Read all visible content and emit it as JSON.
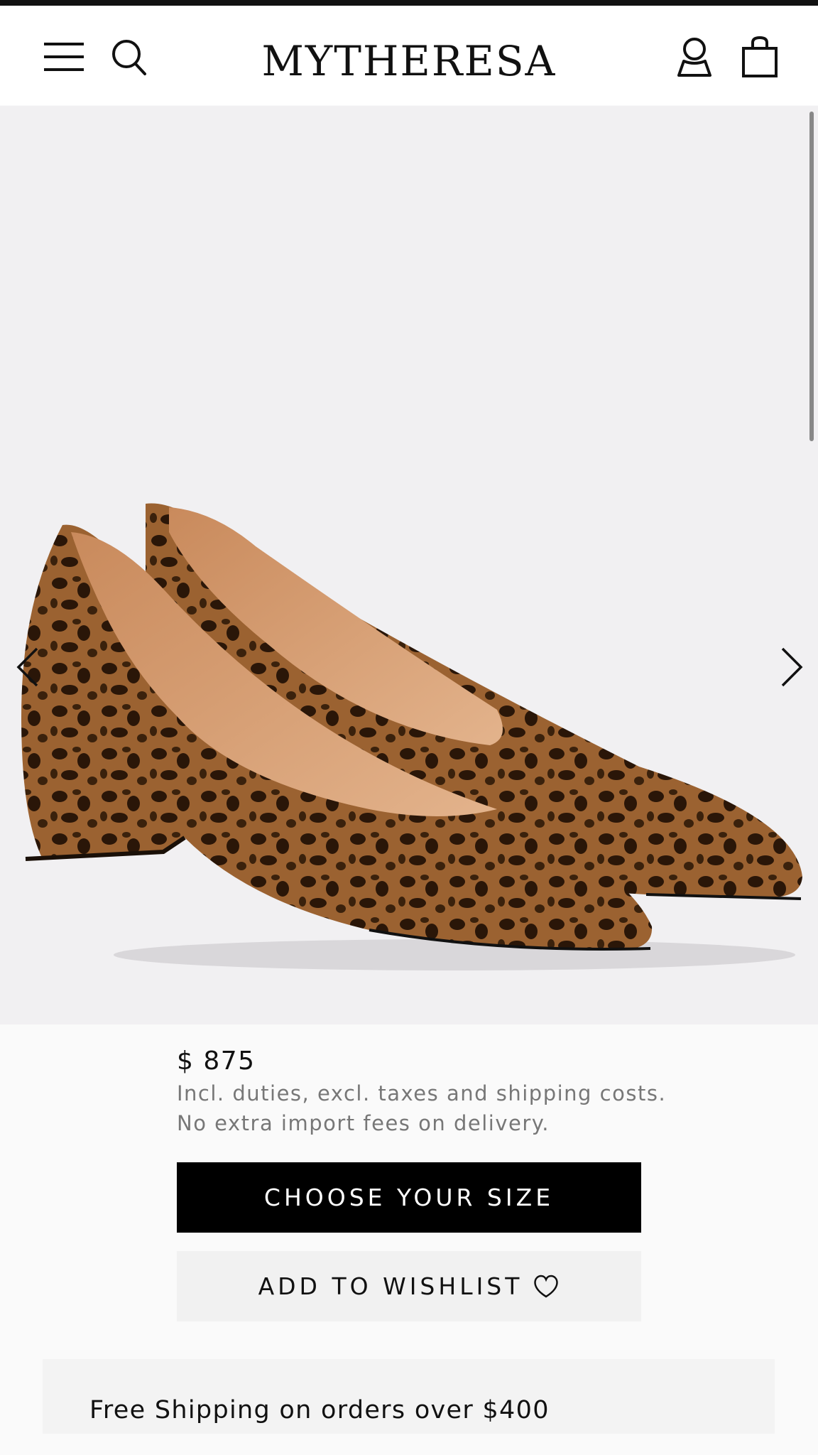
{
  "header": {
    "logo": "MYTHERESA",
    "icons": [
      "menu-icon",
      "search-icon",
      "account-icon",
      "bag-icon"
    ]
  },
  "gallery": {
    "prev_icon": "chevron-left-icon",
    "next_icon": "chevron-right-icon",
    "image": "leopard-print-suede-pumps"
  },
  "product": {
    "price": "$ 875",
    "note_line1": "Incl. duties, excl. taxes and shipping costs.",
    "note_line2": "No extra import fees on delivery."
  },
  "actions": {
    "choose_size": "CHOOSE YOUR SIZE",
    "wishlist": "ADD TO WISHLIST"
  },
  "promo": {
    "shipping": "Free Shipping on orders over $400"
  },
  "colors": {
    "primary_button": "#000000",
    "secondary_button": "#f1f1f1",
    "image_background": "#f1f0f2"
  }
}
